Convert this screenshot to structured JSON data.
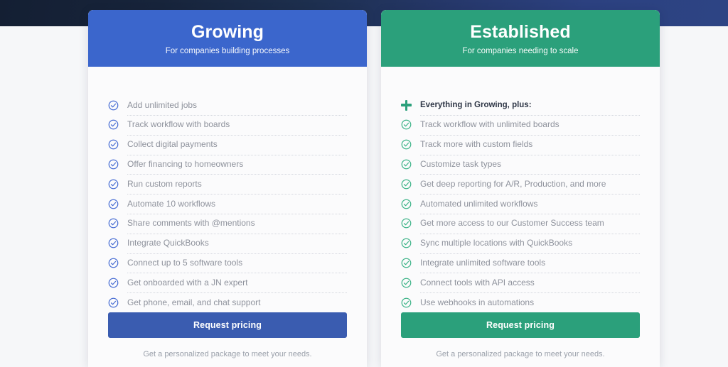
{
  "theme": {
    "band_dark": "#141f33",
    "band_light": "#2d4484",
    "page_bg": "#f6f7f9",
    "card_bg": "#fbfbfc",
    "growing_accent": "#3b66cc",
    "growing_button": "#3a5cb0",
    "established_accent": "#2ba07b",
    "feature_text": "#8e929c",
    "divider": "#d3d6de"
  },
  "plans": [
    {
      "id": "growing",
      "title": "Growing",
      "subtitle": "For companies building processes",
      "icon": "check-circle-icon",
      "features": [
        {
          "label": "Add unlimited jobs",
          "icon": "check-circle-icon",
          "highlight": false
        },
        {
          "label": "Track workflow with boards",
          "icon": "check-circle-icon",
          "highlight": false
        },
        {
          "label": "Collect digital payments",
          "icon": "check-circle-icon",
          "highlight": false
        },
        {
          "label": "Offer financing to homeowners",
          "icon": "check-circle-icon",
          "highlight": false
        },
        {
          "label": "Run custom reports",
          "icon": "check-circle-icon",
          "highlight": false
        },
        {
          "label": "Automate 10 workflows",
          "icon": "check-circle-icon",
          "highlight": false
        },
        {
          "label": "Share comments with @mentions",
          "icon": "check-circle-icon",
          "highlight": false
        },
        {
          "label": "Integrate QuickBooks",
          "icon": "check-circle-icon",
          "highlight": false
        },
        {
          "label": "Connect up to 5 software tools",
          "icon": "check-circle-icon",
          "highlight": false
        },
        {
          "label": "Get onboarded with a JN expert",
          "icon": "check-circle-icon",
          "highlight": false
        },
        {
          "label": "Get phone, email, and chat support",
          "icon": "check-circle-icon",
          "highlight": false
        }
      ],
      "cta_label": "Request pricing",
      "cta_note": "Get a personalized package to meet your needs."
    },
    {
      "id": "established",
      "title": "Established",
      "subtitle": "For companies needing to scale",
      "icon": "check-circle-icon",
      "features": [
        {
          "label": "Everything in Growing, plus:",
          "icon": "plus-icon",
          "highlight": true
        },
        {
          "label": "Track workflow with unlimited boards",
          "icon": "check-circle-icon",
          "highlight": false
        },
        {
          "label": "Track more with custom fields",
          "icon": "check-circle-icon",
          "highlight": false
        },
        {
          "label": "Customize task types",
          "icon": "check-circle-icon",
          "highlight": false
        },
        {
          "label": "Get deep reporting for A/R, Production, and more",
          "icon": "check-circle-icon",
          "highlight": false
        },
        {
          "label": "Automated unlimited workflows",
          "icon": "check-circle-icon",
          "highlight": false
        },
        {
          "label": "Get more access to our Customer Success team",
          "icon": "check-circle-icon",
          "highlight": false
        },
        {
          "label": "Sync multiple locations with QuickBooks",
          "icon": "check-circle-icon",
          "highlight": false
        },
        {
          "label": "Integrate unlimited software tools",
          "icon": "check-circle-icon",
          "highlight": false
        },
        {
          "label": "Connect tools with API access",
          "icon": "check-circle-icon",
          "highlight": false
        },
        {
          "label": "Use webhooks in automations",
          "icon": "check-circle-icon",
          "highlight": false
        }
      ],
      "cta_label": "Request pricing",
      "cta_note": "Get a personalized package to meet your needs."
    }
  ]
}
